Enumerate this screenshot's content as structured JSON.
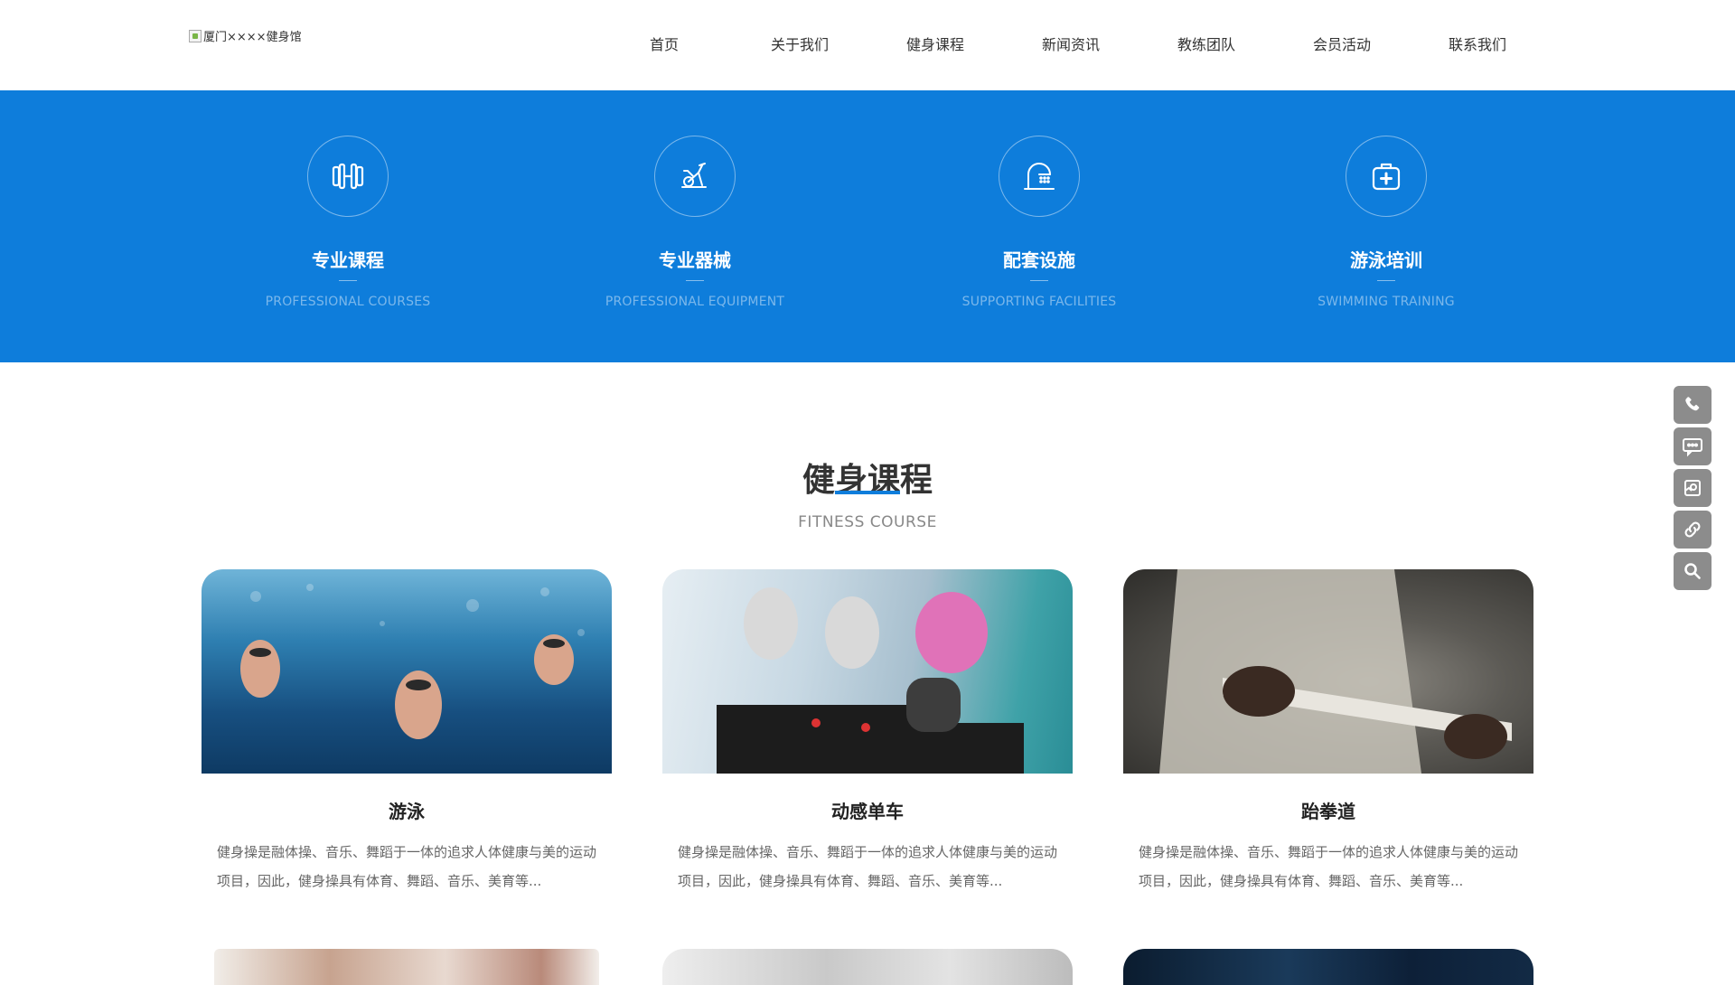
{
  "header": {
    "logo_alt": "厦门××××健身馆",
    "nav": [
      "首页",
      "关于我们",
      "健身课程",
      "新闻资讯",
      "教练团队",
      "会员活动",
      "联系我们"
    ]
  },
  "features": [
    {
      "title": "专业课程",
      "subtitle": "PROFESSIONAL COURSES",
      "icon": "dumbbell-icon"
    },
    {
      "title": "专业器械",
      "subtitle": "PROFESSIONAL EQUIPMENT",
      "icon": "exercise-bike-icon"
    },
    {
      "title": "配套设施",
      "subtitle": "SUPPORTING FACILITIES",
      "icon": "shower-icon"
    },
    {
      "title": "游泳培训",
      "subtitle": "SWIMMING TRAINING",
      "icon": "first-aid-kit-icon"
    }
  ],
  "courses_section": {
    "title": "健身课程",
    "subtitle": "FITNESS COURSE",
    "cards": [
      {
        "name": "游泳",
        "desc": "健身操是融体操、音乐、舞蹈于一体的追求人体健康与美的运动项目，因此，健身操具有体育、舞蹈、音乐、美育等..."
      },
      {
        "name": "动感单车",
        "desc": "健身操是融体操、音乐、舞蹈于一体的追求人体健康与美的运动项目，因此，健身操具有体育、舞蹈、音乐、美育等..."
      },
      {
        "name": "跆拳道",
        "desc": "健身操是融体操、音乐、舞蹈于一体的追求人体健康与美的运动项目，因此，健身操具有体育、舞蹈、音乐、美育等..."
      }
    ]
  },
  "sidebar": {
    "buttons": [
      "phone-icon",
      "message-icon",
      "qrcode-icon",
      "link-icon",
      "search-icon"
    ]
  },
  "colors": {
    "brand_blue": "#0e7ddb",
    "sidebar_gray": "#8c8c8c"
  }
}
